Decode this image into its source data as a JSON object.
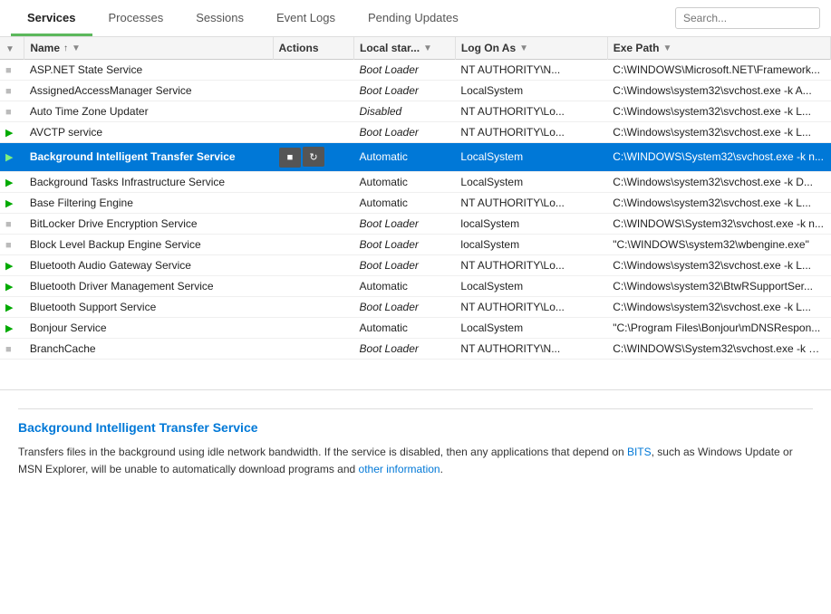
{
  "nav": {
    "tabs": [
      {
        "label": "Services",
        "active": true
      },
      {
        "label": "Processes",
        "active": false
      },
      {
        "label": "Sessions",
        "active": false
      },
      {
        "label": "Event Logs",
        "active": false
      },
      {
        "label": "Pending Updates",
        "active": false
      }
    ],
    "search_placeholder": "Search..."
  },
  "table": {
    "columns": [
      {
        "label": "",
        "key": "status_icon"
      },
      {
        "label": "Name",
        "key": "name",
        "sortable": true,
        "filterable": true
      },
      {
        "label": "Actions",
        "key": "actions"
      },
      {
        "label": "Local star...",
        "key": "local_start",
        "filterable": true
      },
      {
        "label": "Log On As",
        "key": "logon",
        "filterable": true
      },
      {
        "label": "Exe Path",
        "key": "exe_path",
        "filterable": true
      }
    ],
    "rows": [
      {
        "status": "stopped",
        "name": "ASP.NET State Service",
        "actions": "",
        "local_start": "Boot Loader",
        "logon": "NT AUTHORITY\\N...",
        "exe_path": "C:\\WINDOWS\\Microsoft.NET\\Framework...",
        "italic_start": true
      },
      {
        "status": "stopped",
        "name": "AssignedAccessManager Service",
        "actions": "",
        "local_start": "Boot Loader",
        "logon": "LocalSystem",
        "exe_path": "C:\\Windows\\system32\\svchost.exe -k A...",
        "italic_start": true
      },
      {
        "status": "stopped",
        "name": "Auto Time Zone Updater",
        "actions": "",
        "local_start": "Disabled",
        "logon": "NT AUTHORITY\\Lo...",
        "exe_path": "C:\\Windows\\system32\\svchost.exe -k L...",
        "italic_start": true
      },
      {
        "status": "running",
        "name": "AVCTP service",
        "actions": "",
        "local_start": "Boot Loader",
        "logon": "NT AUTHORITY\\Lo...",
        "exe_path": "C:\\Windows\\system32\\svchost.exe -k L...",
        "italic_start": true
      },
      {
        "status": "running_selected",
        "name": "Background Intelligent Transfer Service",
        "actions": "stop,restart",
        "local_start": "Automatic",
        "logon": "LocalSystem",
        "exe_path": "C:\\WINDOWS\\System32\\svchost.exe -k n...",
        "selected": true,
        "italic_start": false
      },
      {
        "status": "running",
        "name": "Background Tasks Infrastructure Service",
        "actions": "",
        "local_start": "Automatic",
        "logon": "LocalSystem",
        "exe_path": "C:\\Windows\\system32\\svchost.exe -k D...",
        "italic_start": false
      },
      {
        "status": "running",
        "name": "Base Filtering Engine",
        "actions": "",
        "local_start": "Automatic",
        "logon": "NT AUTHORITY\\Lo...",
        "exe_path": "C:\\Windows\\system32\\svchost.exe -k L...",
        "italic_start": false
      },
      {
        "status": "stopped",
        "name": "BitLocker Drive Encryption Service",
        "actions": "",
        "local_start": "Boot Loader",
        "logon": "localSystem",
        "exe_path": "C:\\WINDOWS\\System32\\svchost.exe -k n...",
        "italic_start": true
      },
      {
        "status": "stopped",
        "name": "Block Level Backup Engine Service",
        "actions": "",
        "local_start": "Boot Loader",
        "logon": "localSystem",
        "exe_path": "\"C:\\WINDOWS\\system32\\wbengine.exe\"",
        "italic_start": true
      },
      {
        "status": "running",
        "name": "Bluetooth Audio Gateway Service",
        "actions": "",
        "local_start": "Boot Loader",
        "logon": "NT AUTHORITY\\Lo...",
        "exe_path": "C:\\Windows\\system32\\svchost.exe -k L...",
        "italic_start": true
      },
      {
        "status": "running",
        "name": "Bluetooth Driver Management Service",
        "actions": "",
        "local_start": "Automatic",
        "logon": "LocalSystem",
        "exe_path": "C:\\Windows\\system32\\BtwRSupportSer...",
        "italic_start": false
      },
      {
        "status": "running",
        "name": "Bluetooth Support Service",
        "actions": "",
        "local_start": "Boot Loader",
        "logon": "NT AUTHORITY\\Lo...",
        "exe_path": "C:\\Windows\\system32\\svchost.exe -k L...",
        "italic_start": true
      },
      {
        "status": "running",
        "name": "Bonjour Service",
        "actions": "",
        "local_start": "Automatic",
        "logon": "LocalSystem",
        "exe_path": "\"C:\\Program Files\\Bonjour\\mDNSRespon...",
        "italic_start": false
      },
      {
        "status": "stopped",
        "name": "BranchCache",
        "actions": "",
        "local_start": "Boot Loader",
        "logon": "NT AUTHORITY\\N...",
        "exe_path": "C:\\WINDOWS\\System32\\svchost.exe -k R...",
        "italic_start": true
      }
    ]
  },
  "detail": {
    "title": "Background Intelligent Transfer Service",
    "description_parts": [
      {
        "text": "Transfers files in the background using idle network bandwidth. If the service is disabled, then any applications that depend on ",
        "type": "normal"
      },
      {
        "text": "BITS",
        "type": "link"
      },
      {
        "text": ", such as Windows Update or MSN Explorer, will be unable to automatically download programs and ",
        "type": "normal"
      },
      {
        "text": "other information",
        "type": "link"
      },
      {
        "text": ".",
        "type": "normal"
      }
    ],
    "description_plain": "Transfers files in the background using idle network bandwidth. If the service is disabled, then any applications that depend on BITS, such as Windows Update or MSN Explorer, will be unable to automatically download programs and other information."
  }
}
